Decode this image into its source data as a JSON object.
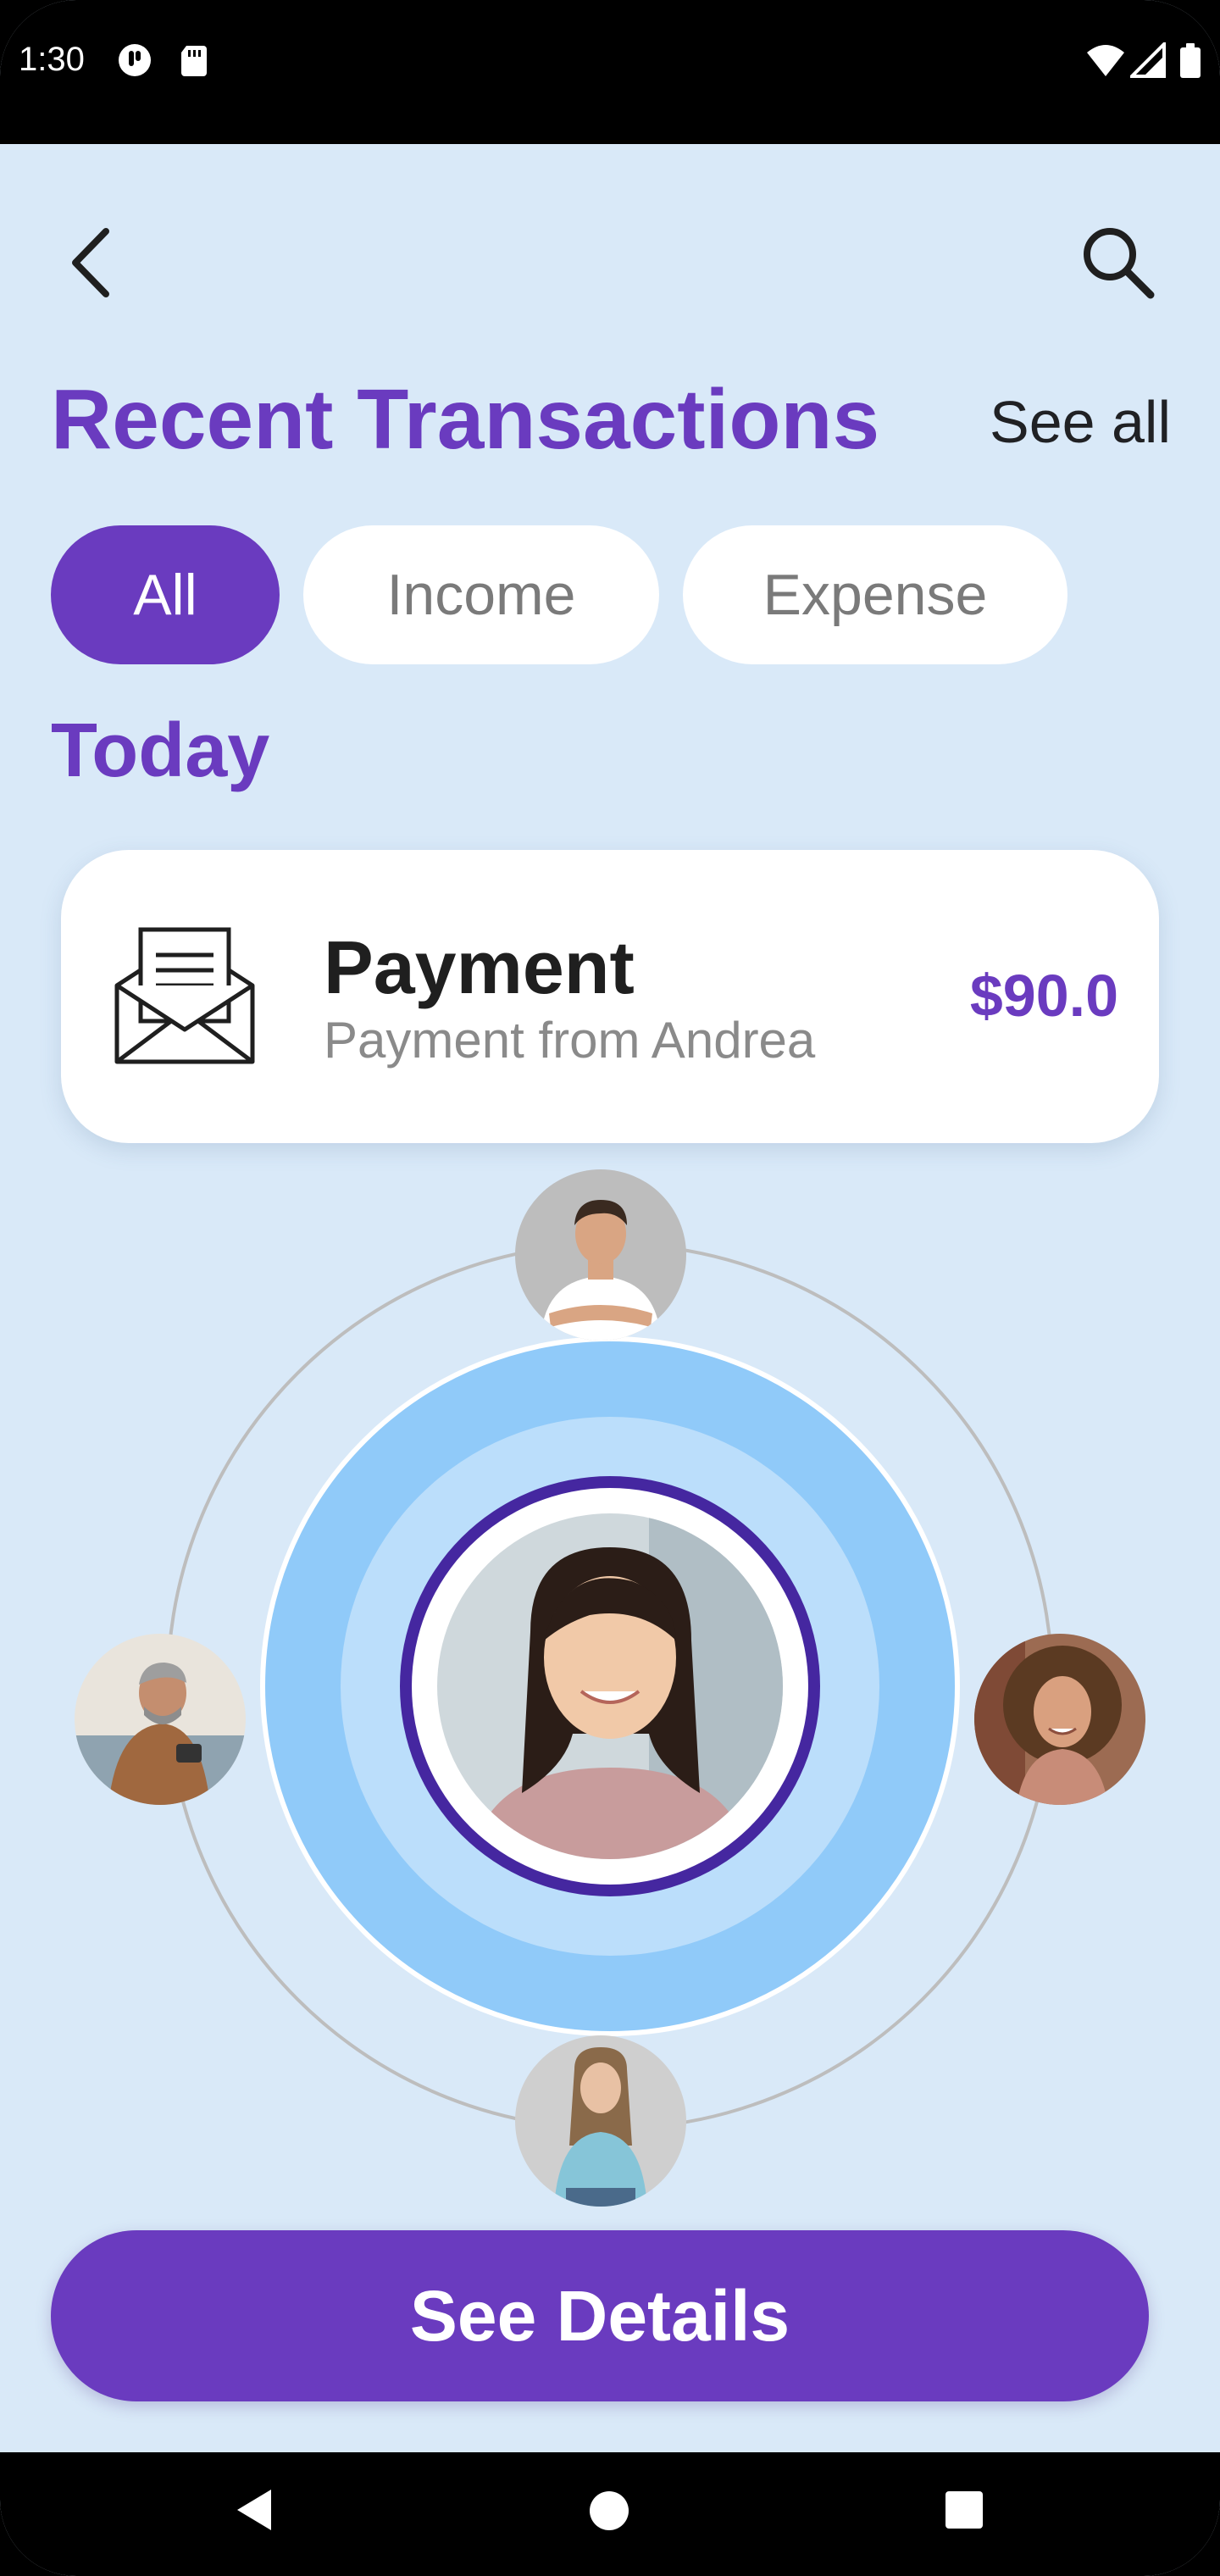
{
  "status_bar": {
    "time": "1:30"
  },
  "header": {
    "title": "Recent Transactions",
    "see_all": "See all"
  },
  "filters": [
    {
      "label": "All",
      "active": true
    },
    {
      "label": "Income",
      "active": false
    },
    {
      "label": "Expense",
      "active": false
    }
  ],
  "section": {
    "label": "Today"
  },
  "transaction": {
    "icon": "envelope-icon",
    "title": "Payment",
    "subtitle": "Payment from Andrea",
    "amount": "$90.0"
  },
  "contacts": {
    "center": "avatar-center-woman",
    "top": "avatar-man-white-shirt",
    "left": "avatar-man-phone",
    "right": "avatar-woman-curly",
    "bottom": "avatar-woman-blue-shirt"
  },
  "cta": {
    "label": "See Details"
  },
  "colors": {
    "accent": "#6a3bbf",
    "background": "#d9e9f8",
    "ring_outer": "#90caf9",
    "ring_inner": "#bbdefb",
    "ring_dark": "#4527a0"
  }
}
